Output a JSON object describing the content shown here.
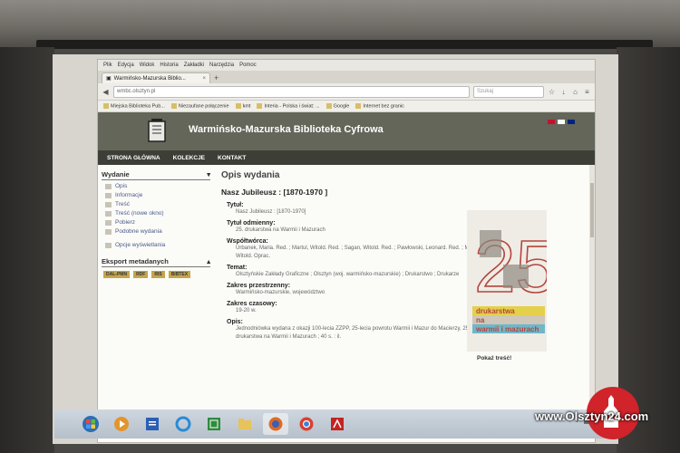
{
  "browser": {
    "menu": [
      "Plik",
      "Edycja",
      "Widok",
      "Historia",
      "Zakładki",
      "Narzędzia",
      "Pomoc"
    ],
    "tab_title": "Warmińsko-Mazurska Biblio...",
    "url": "wmbc.olsztyn.pl",
    "search_placeholder": "Szukaj",
    "bookmarks": [
      "Miejska Biblioteka Pub...",
      "Niezaufane połączenie",
      "kmt",
      "Interia - Polska i świat: ...",
      "Google",
      "Internet bez granic"
    ]
  },
  "site": {
    "title": "Warmińsko-Mazurska Biblioteka Cyfrowa",
    "nav": [
      "STRONA GŁÓWNA",
      "KOLEKCJE",
      "KONTAKT"
    ],
    "flags": [
      "#c8102e",
      "#ffffff",
      "#00247d"
    ]
  },
  "sidebar": {
    "head": "Wydanie",
    "items": [
      "Opis",
      "Informacje",
      "Treść",
      "Treść (nowe okno)",
      "Pobierz",
      "Podobne wydania"
    ],
    "options": "Opcje wyświetlania",
    "export_head": "Eksport metadanych",
    "export_badges": [
      "DAL-PMN",
      "RDF",
      "RIS",
      "BIBTEX"
    ]
  },
  "main": {
    "heading": "Opis wydania",
    "subtitle": "Nasz Jubileusz : [1870-1970 ]",
    "fields": [
      {
        "label": "Tytuł:",
        "value": "Nasz Jubileusz : [1870-1970]"
      },
      {
        "label": "Tytuł odmienny:",
        "value": "25. drukarstwa na Warmii i Mazurach"
      },
      {
        "label": "Współtwórca:",
        "value": "Urbanek, Maria. Red. ; Martul, Witold. Red. ; Sagan, Witold. Red. ; Pawłowski, Leonard. Red. ; Martul, Witold. Oprac."
      },
      {
        "label": "Temat:",
        "value": "Olsztyńskie Zakłady Graficzne ; Olsztyn (woj. warmińsko-mazurskie) ; Drukarstwo ; Drukarze"
      },
      {
        "label": "Zakres przestrzenny:",
        "value": "Warmińsko-mazurskie, województwo"
      },
      {
        "label": "Zakres czasowy:",
        "value": "19-20 w."
      },
      {
        "label": "Opis:",
        "value": "Jednodniówka wydana z okazji 100-lecia ZZPP, 25-lecia powrotu Warmii i Mazur do Macierzy, 25-lecia drukarstwa na Warmii i Mazurach ; 40 s. : il."
      }
    ],
    "cover_number": "25",
    "cover_lines": [
      "drukarstwa",
      "na",
      "warmii i mazurach"
    ],
    "cover_caption": "Pokaż treść!"
  },
  "watermark": "www.Olsztyn24.com"
}
